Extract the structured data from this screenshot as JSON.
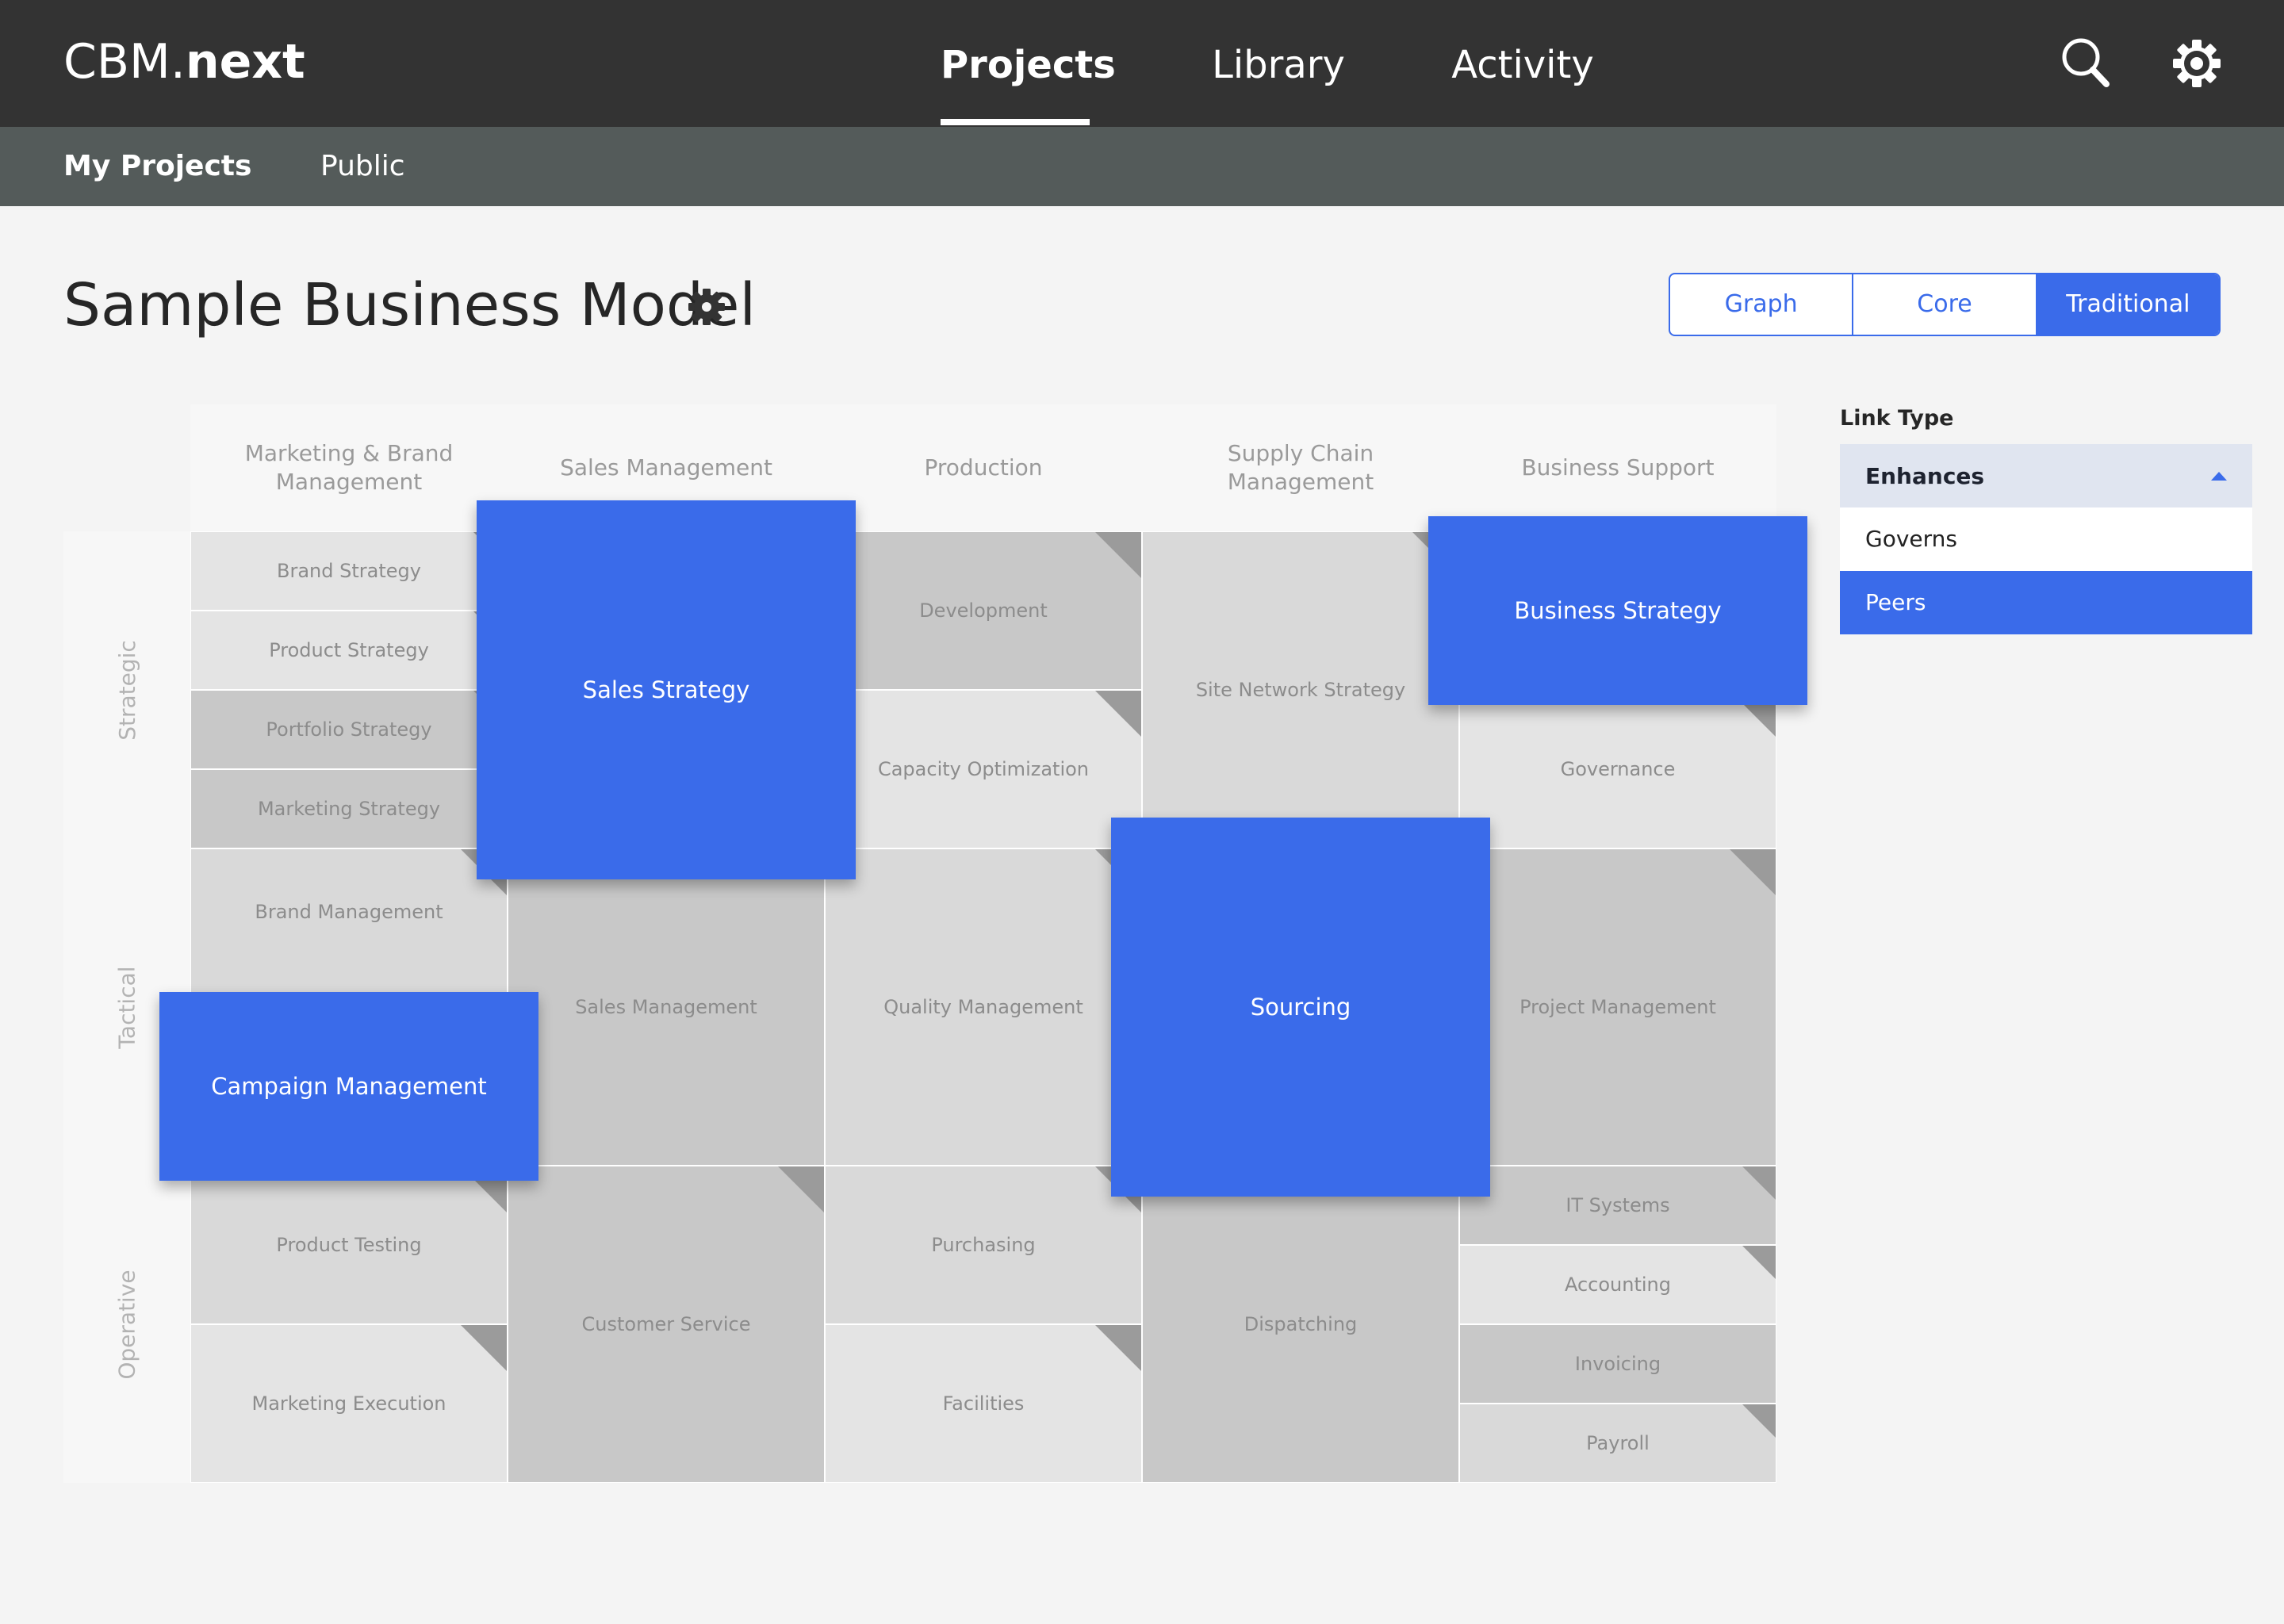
{
  "header": {
    "brand_prefix": "CBM.",
    "brand_suffix": "next",
    "tabs": [
      {
        "label": "Projects",
        "active": true
      },
      {
        "label": "Library",
        "active": false
      },
      {
        "label": "Activity",
        "active": false
      }
    ],
    "icons": [
      "search-icon",
      "settings-gear-icon"
    ]
  },
  "subnav": {
    "tabs": [
      {
        "label": "My Projects",
        "active": true
      },
      {
        "label": "Public",
        "active": false
      }
    ]
  },
  "page": {
    "title": "Sample Business Model",
    "title_icon": "gear-icon",
    "view_modes": [
      {
        "label": "Graph",
        "selected": false
      },
      {
        "label": "Core",
        "selected": false
      },
      {
        "label": "Traditional",
        "selected": true
      }
    ]
  },
  "matrix": {
    "columns": [
      "Marketing & Brand Management",
      "Sales Management",
      "Production",
      "Supply Chain Management",
      "Business Support"
    ],
    "rows": [
      "Strategic",
      "Tactical",
      "Operative"
    ],
    "components": {
      "brand_strategy": "Brand Strategy",
      "product_strategy": "Product Strategy",
      "portfolio_strategy": "Portfolio Strategy",
      "marketing_strategy": "Marketing Strategy",
      "brand_management": "Brand Management",
      "product_testing": "Product Testing",
      "marketing_execution": "Marketing Execution",
      "sales_management": "Sales Management",
      "customer_service": "Customer Service",
      "development": "Development",
      "capacity_optimization": "Capacity Optimization",
      "quality_management": "Quality Management",
      "purchasing": "Purchasing",
      "facilities": "Facilities",
      "site_network_strategy": "Site Network Strategy",
      "dispatching": "Dispatching",
      "governance": "Governance",
      "project_management": "Project Management",
      "it_systems": "IT Systems",
      "accounting": "Accounting",
      "invoicing": "Invoicing",
      "payroll": "Payroll"
    },
    "highlighted": {
      "sales_strategy": "Sales Strategy",
      "business_strategy": "Business Strategy",
      "campaign_management": "Campaign Management",
      "sourcing": "Sourcing"
    },
    "highlight_color": "#3a6bea"
  },
  "link_type": {
    "label": "Link Type",
    "selected": "Enhances",
    "options": [
      {
        "label": "Governs",
        "selected": false
      },
      {
        "label": "Peers",
        "selected": true
      }
    ]
  }
}
